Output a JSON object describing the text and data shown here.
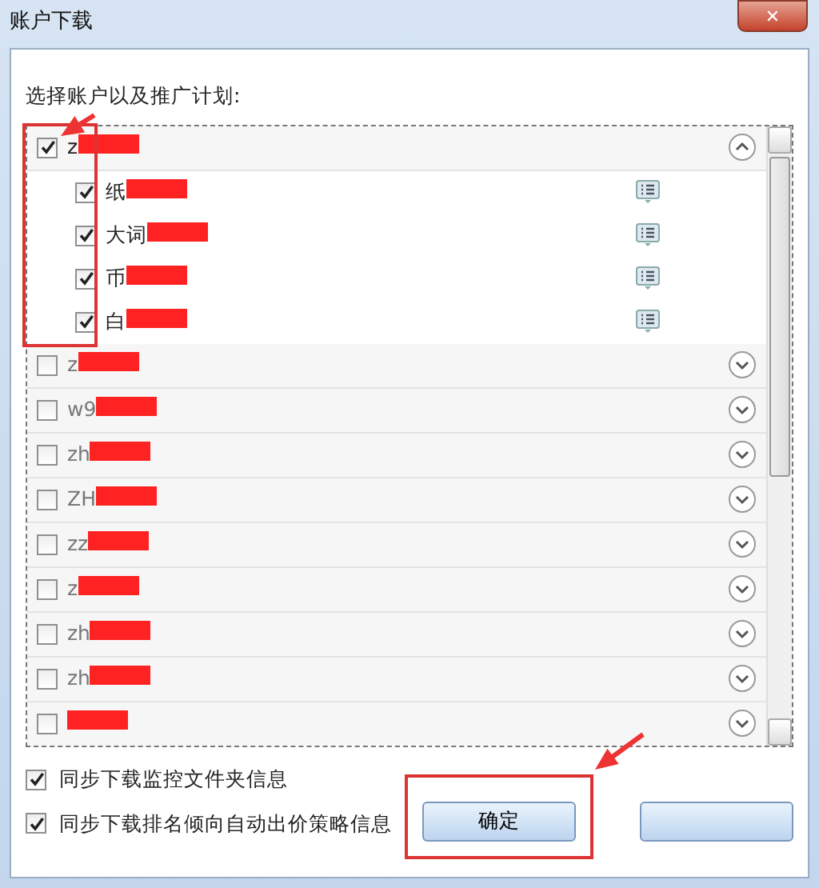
{
  "window": {
    "title": "账户下载",
    "close": "✕"
  },
  "prompt": "选择账户以及推广计划:",
  "accounts": [
    {
      "label": "z",
      "checked": true,
      "expanded": true,
      "redacted": true,
      "annotated": true,
      "plans": [
        {
          "label": "纸",
          "checked": true,
          "redacted": true
        },
        {
          "label": "大词",
          "checked": true,
          "redacted": true
        },
        {
          "label": "币",
          "checked": true,
          "redacted": true
        },
        {
          "label": "白",
          "checked": true,
          "redacted": true
        }
      ]
    },
    {
      "label": "z",
      "checked": false,
      "expanded": false,
      "redacted": true,
      "annotated": false
    },
    {
      "label": "w9",
      "checked": false,
      "expanded": false,
      "redacted": true,
      "annotated": false
    },
    {
      "label": "zh",
      "checked": false,
      "expanded": false,
      "redacted": true,
      "annotated": false
    },
    {
      "label": "ZH",
      "checked": false,
      "expanded": false,
      "redacted": true,
      "annotated": false
    },
    {
      "label": "zz",
      "checked": false,
      "expanded": false,
      "redacted": true,
      "annotated": false
    },
    {
      "label": "z",
      "checked": false,
      "expanded": false,
      "redacted": true,
      "annotated": false
    },
    {
      "label": "zh",
      "checked": false,
      "expanded": false,
      "redacted": true,
      "annotated": false
    },
    {
      "label": "zh",
      "checked": false,
      "expanded": false,
      "redacted": true,
      "annotated": false
    },
    {
      "checked": false,
      "expanded": false,
      "redacted": true,
      "annotated": false
    }
  ],
  "options": [
    {
      "label": "同步下载监控文件夹信息",
      "checked": true
    },
    {
      "label": "同步下载排名倾向自动出价策略信息",
      "checked": true
    }
  ],
  "buttons": [
    {
      "label": "确定",
      "annotated": true
    },
    {
      "annotated": false
    }
  ]
}
